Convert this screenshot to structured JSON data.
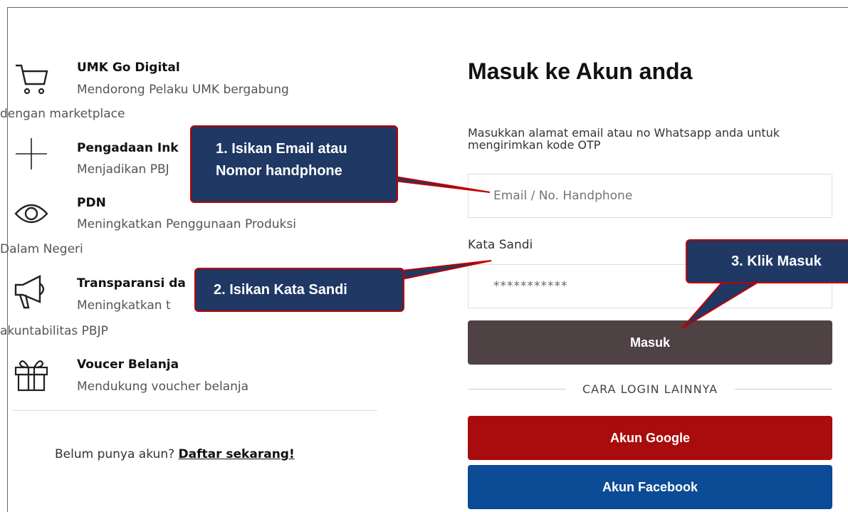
{
  "features": [
    {
      "icon": "cart-icon",
      "title": "UMK Go Digital",
      "desc_line1": "Mendorong Pelaku UMK bergabung",
      "desc_line2": "dengan marketplace"
    },
    {
      "icon": "plus-icon",
      "title": "Pengadaan Ink",
      "desc_line1": "Menjadikan PBJ",
      "desc_line2": ""
    },
    {
      "icon": "eye-icon",
      "title": "PDN",
      "desc_line1": "Meningkatkan Penggunaan Produksi",
      "desc_line2": "Dalam Negeri"
    },
    {
      "icon": "megaphone-icon",
      "title": "Transparansi da",
      "desc_line1": "Meningkatkan t",
      "desc_line2": "akuntabilitas PBJP"
    },
    {
      "icon": "gift-icon",
      "title": "Voucer Belanja",
      "desc_line1": "Mendukung voucher belanja",
      "desc_line2": ""
    }
  ],
  "signup": {
    "prompt": "Belum punya akun?",
    "link": "Daftar sekarang!"
  },
  "form": {
    "title": "Masuk ke Akun anda",
    "description": "Masukkan alamat email atau no Whatsapp anda untuk mengirimkan kode OTP",
    "email_placeholder": "Email / No. Handphone",
    "password_label": "Kata Sandi",
    "password_value": "***********",
    "submit_label": "Masuk",
    "alt_login_label": "CARA LOGIN LAINNYA",
    "google_label": "Akun Google",
    "facebook_label": "Akun Facebook"
  },
  "callouts": {
    "step1_line1": "1. Isikan Email atau",
    "step1_line2": "Nomor handphone",
    "step2": "2. Isikan Kata Sandi",
    "step3": "3. Klik Masuk"
  },
  "colors": {
    "submit_button": "#4f4244",
    "google_button": "#a90c0c",
    "facebook_button": "#0c4b96",
    "callout_fill": "#1f3864",
    "callout_border": "#c00000"
  }
}
